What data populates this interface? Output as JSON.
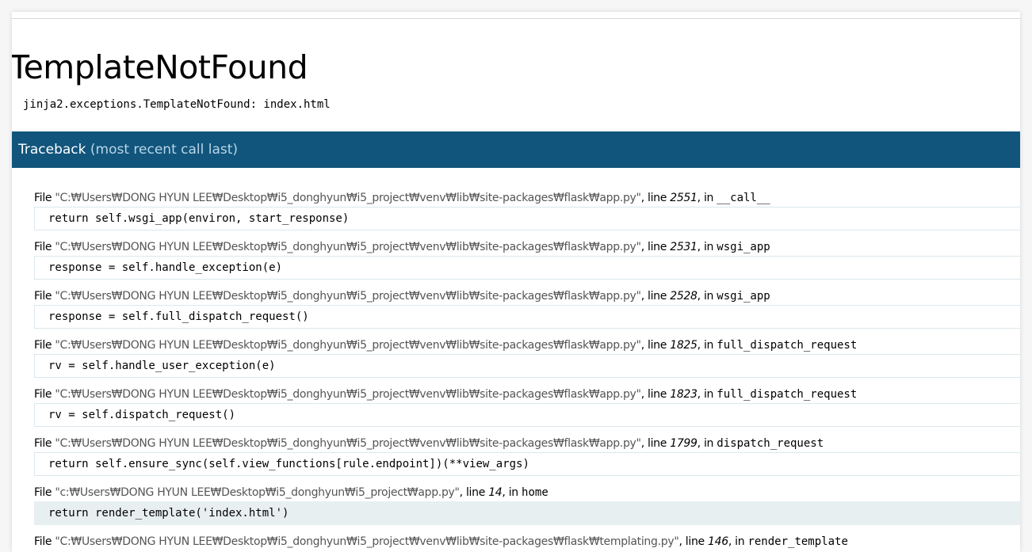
{
  "error": {
    "title": "TemplateNotFound",
    "message": "jinja2.exceptions.TemplateNotFound: index.html"
  },
  "traceback": {
    "heading": "Traceback",
    "subheading": "(most recent call last)",
    "file_prefix": "File",
    "line_prefix": ", line",
    "in_prefix": ", in",
    "frames": [
      {
        "filename": "\"C:₩Users₩DONG HYUN LEE₩Desktop₩i5_donghyun₩i5_project₩venv₩lib₩site-packages₩flask₩app.py\"",
        "lineno": "2551",
        "func": "__call__",
        "code": "return self.wsgi_app(environ, start_response)",
        "current": false
      },
      {
        "filename": "\"C:₩Users₩DONG HYUN LEE₩Desktop₩i5_donghyun₩i5_project₩venv₩lib₩site-packages₩flask₩app.py\"",
        "lineno": "2531",
        "func": "wsgi_app",
        "code": "response = self.handle_exception(e)",
        "current": false
      },
      {
        "filename": "\"C:₩Users₩DONG HYUN LEE₩Desktop₩i5_donghyun₩i5_project₩venv₩lib₩site-packages₩flask₩app.py\"",
        "lineno": "2528",
        "func": "wsgi_app",
        "code": "response = self.full_dispatch_request()",
        "current": false
      },
      {
        "filename": "\"C:₩Users₩DONG HYUN LEE₩Desktop₩i5_donghyun₩i5_project₩venv₩lib₩site-packages₩flask₩app.py\"",
        "lineno": "1825",
        "func": "full_dispatch_request",
        "code": "rv = self.handle_user_exception(e)",
        "current": false
      },
      {
        "filename": "\"C:₩Users₩DONG HYUN LEE₩Desktop₩i5_donghyun₩i5_project₩venv₩lib₩site-packages₩flask₩app.py\"",
        "lineno": "1823",
        "func": "full_dispatch_request",
        "code": "rv = self.dispatch_request()",
        "current": false
      },
      {
        "filename": "\"C:₩Users₩DONG HYUN LEE₩Desktop₩i5_donghyun₩i5_project₩venv₩lib₩site-packages₩flask₩app.py\"",
        "lineno": "1799",
        "func": "dispatch_request",
        "code": "return self.ensure_sync(self.view_functions[rule.endpoint])(**view_args)",
        "current": false
      },
      {
        "filename": "\"c:₩Users₩DONG HYUN LEE₩Desktop₩i5_donghyun₩i5_project₩app.py\"",
        "lineno": "14",
        "func": "home",
        "code": "return render_template('index.html')",
        "current": true
      },
      {
        "filename": "\"C:₩Users₩DONG HYUN LEE₩Desktop₩i5_donghyun₩i5_project₩venv₩lib₩site-packages₩flask₩templating.py\"",
        "lineno": "146",
        "func": "render_template",
        "code": "",
        "current": false
      }
    ]
  },
  "colors": {
    "header_bg": "#11557c",
    "header_text": "#ffffff",
    "header_subtext": "#b8d6e8",
    "current_line_bg": "#e8eff0",
    "filename_text": "#555555"
  }
}
